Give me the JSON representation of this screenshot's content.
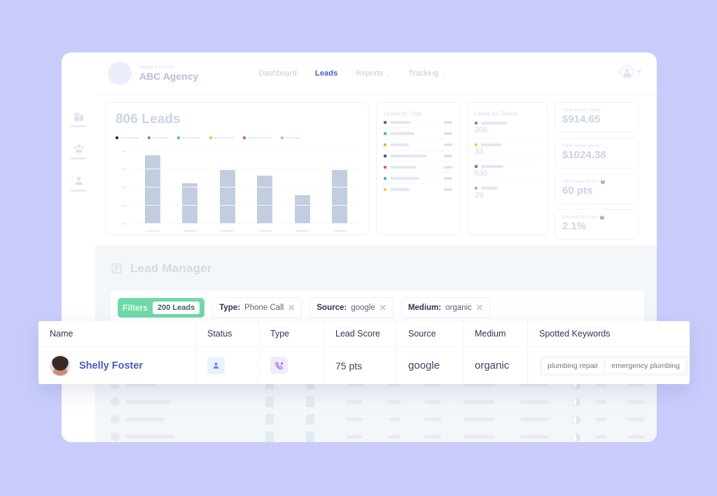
{
  "topbar": {
    "menu_icon": "hamburger-icon",
    "brand_sub": "Viewing Profile",
    "brand_name": "ABC Agency",
    "nav": [
      {
        "label": "Dashboard",
        "active": false,
        "caret": ""
      },
      {
        "label": "Leads",
        "active": true,
        "caret": ""
      },
      {
        "label": "Reports",
        "active": false,
        "caret": "⌄"
      },
      {
        "label": "Tracking",
        "active": false,
        "caret": "⌄"
      }
    ],
    "user_icon": "user-circle-icon"
  },
  "rail": {
    "items": [
      {
        "icon": "building-icon"
      },
      {
        "icon": "agency-group-icon"
      },
      {
        "icon": "person-icon"
      }
    ]
  },
  "chart_data": {
    "type": "bar",
    "title": "806 Leads",
    "categories": [
      "",
      "",
      "",
      "",
      "",
      ""
    ],
    "values": [
      97,
      57,
      76,
      68,
      40,
      76
    ],
    "ylim": [
      0,
      100
    ],
    "xlabel": "",
    "ylabel": "",
    "grid": true,
    "legend_position": "top",
    "legend": [
      {
        "label": "",
        "color": "#2e3354"
      },
      {
        "label": "",
        "color": "#7f8ccb"
      },
      {
        "label": "",
        "color": "#54c9b4"
      },
      {
        "label": "",
        "color": "#f5c451"
      },
      {
        "label": "",
        "color": "#e2566f"
      },
      {
        "label": "",
        "color": "#b9bfd2"
      }
    ],
    "bar_color": "#c3cde1",
    "ytick_count": 5
  },
  "leads_by_type": {
    "title": "Leads by Type",
    "rows": [
      {
        "color": "#8f4b52",
        "label_w": 30,
        "value": ""
      },
      {
        "color": "#35c3a8",
        "label_w": 35,
        "value": ""
      },
      {
        "color": "#f0a93c",
        "label_w": 27,
        "value": ""
      },
      {
        "color": "#3c5b93",
        "label_w": 52,
        "value": ""
      },
      {
        "color": "#e2566f",
        "label_w": 38,
        "value": ""
      },
      {
        "color": "#35c3a8",
        "label_w": 42,
        "value": ""
      },
      {
        "color": "#f3cc55",
        "label_w": 28,
        "value": ""
      }
    ]
  },
  "leads_by_status": {
    "title": "Leads by Status",
    "rows": [
      {
        "color": "#5aa764",
        "label_w": 38,
        "count": "206"
      },
      {
        "color": "#f3cc55",
        "label_w": 29,
        "count": "33"
      },
      {
        "color": "#c0566a",
        "label_w": 32,
        "count": "538"
      },
      {
        "color": "#a8adc0",
        "label_w": 24,
        "count": "29"
      }
    ]
  },
  "stats": [
    {
      "label": "Total Quote Value",
      "value": "$914.65",
      "info": false
    },
    {
      "label": "Total Sales Value",
      "value": "$1024.38",
      "info": false
    },
    {
      "label": "Total Lead Score",
      "value": "60 pts",
      "info": true
    },
    {
      "label": "Conversion Rate",
      "value": "2.1%",
      "info": true
    }
  ],
  "lead_manager": {
    "icon": "lead-list-icon",
    "title": "Lead Manager",
    "filters": {
      "label": "Filters",
      "count": "200 Leads",
      "accent": "#6fd9a8",
      "chips": [
        {
          "key": "Type:",
          "value": "Phone Call",
          "remove": "✕"
        },
        {
          "key": "Source:",
          "value": "google",
          "remove": "✕"
        },
        {
          "key": "Medium:",
          "value": "organic",
          "remove": "✕"
        }
      ]
    },
    "columns": [
      "Name",
      "Status",
      "Type",
      "Lead Score",
      "Source",
      "Medium",
      "Spotted Keywords"
    ],
    "row": {
      "avatar": "lead-avatar",
      "name": "Shelly Foster",
      "status_icon": "person-status-icon",
      "type_icon": "phone-incoming-icon",
      "lead_score": "75 pts",
      "source": "google",
      "medium": "organic",
      "keywords": [
        "plumbing repair",
        "emergency plumbing"
      ]
    }
  },
  "theme": {
    "page_bg": "#c9ccfb",
    "accent_blue": "#4a5bbd",
    "accent_green": "#6fd9a8",
    "panel_bg": "#f3f7fa"
  }
}
